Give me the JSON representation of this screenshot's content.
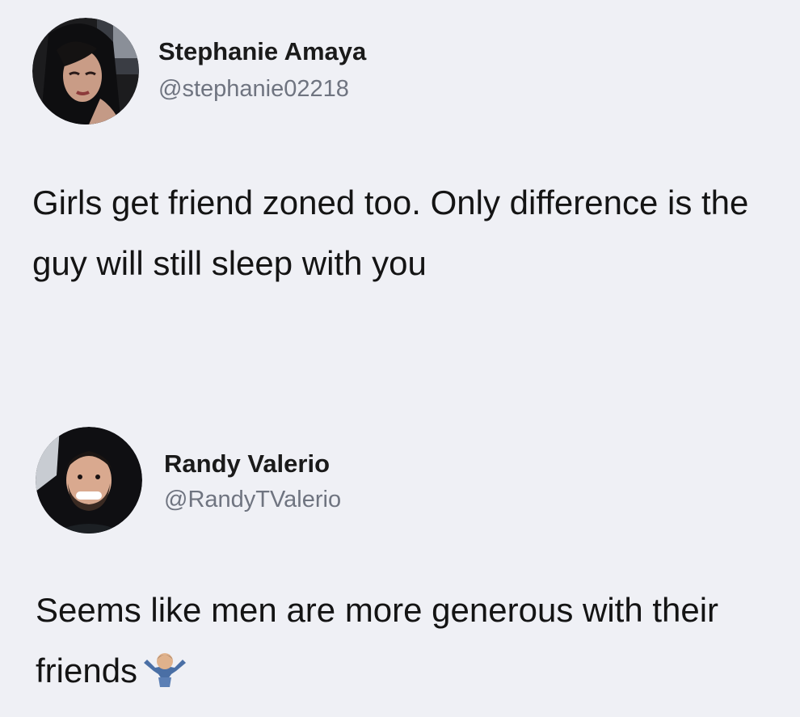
{
  "tweets": [
    {
      "author_name": "Stephanie Amaya",
      "author_handle": "@stephanie02218",
      "avatar_icon": "profile-photo-woman",
      "text": "Girls get friend zoned too. Only difference is the guy will still sleep with you"
    },
    {
      "author_name": "Randy Valerio",
      "author_handle": "@RandyTValerio",
      "avatar_icon": "profile-photo-man",
      "text": "Seems like men are more generous with their friends",
      "emoji_icon": "person-shrugging-emoji"
    }
  ],
  "colors": {
    "background": "#eff0f5",
    "name_text": "#1a1a1a",
    "handle_text": "#6f7480",
    "body_text": "#141414"
  }
}
